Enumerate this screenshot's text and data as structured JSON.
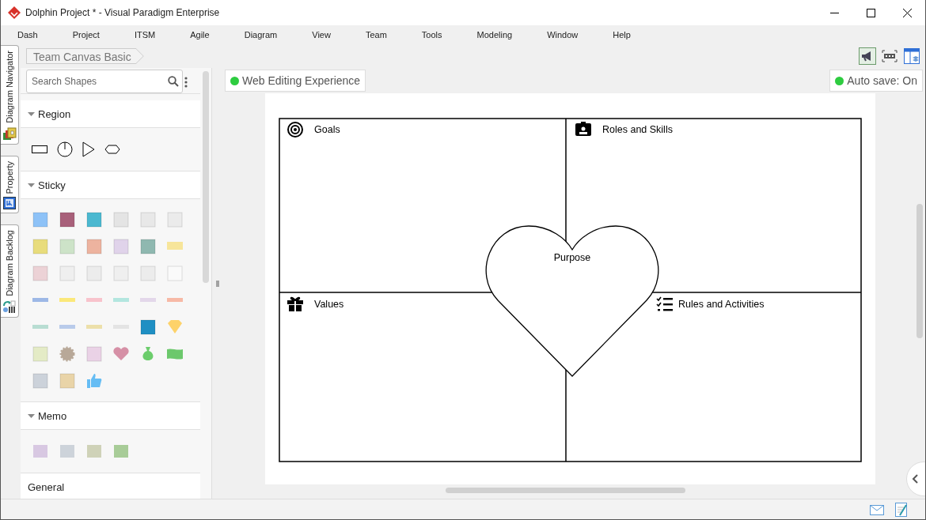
{
  "window": {
    "title": "Dolphin Project * - Visual Paradigm Enterprise"
  },
  "menu": [
    "Dash",
    "Project",
    "ITSM",
    "Agile",
    "Diagram",
    "View",
    "Team",
    "Tools",
    "Modeling",
    "Window",
    "Help"
  ],
  "side_tabs": [
    {
      "label": "Diagram Navigator"
    },
    {
      "label": "Property"
    },
    {
      "label": "Diagram Backlog"
    }
  ],
  "breadcrumb": "Team Canvas Basic",
  "shapes_panel": {
    "search": {
      "placeholder": "Search Shapes"
    },
    "sections": [
      {
        "title": "Region",
        "kind": "region"
      },
      {
        "title": "Sticky",
        "kind": "sticky"
      },
      {
        "title": "Memo",
        "kind": "memo"
      },
      {
        "title": "General",
        "kind": "general"
      }
    ]
  },
  "canvas": {
    "web_editing": "Web Editing Experience",
    "auto_save": "Auto save: On",
    "diagram": {
      "quadrants": [
        {
          "label": "Goals",
          "kind": "goals"
        },
        {
          "label": "Roles and Skills",
          "kind": "roles"
        },
        {
          "label": "Values",
          "kind": "values"
        },
        {
          "label": "Rules and Activities",
          "kind": "rules"
        }
      ],
      "center": "Purpose"
    }
  }
}
